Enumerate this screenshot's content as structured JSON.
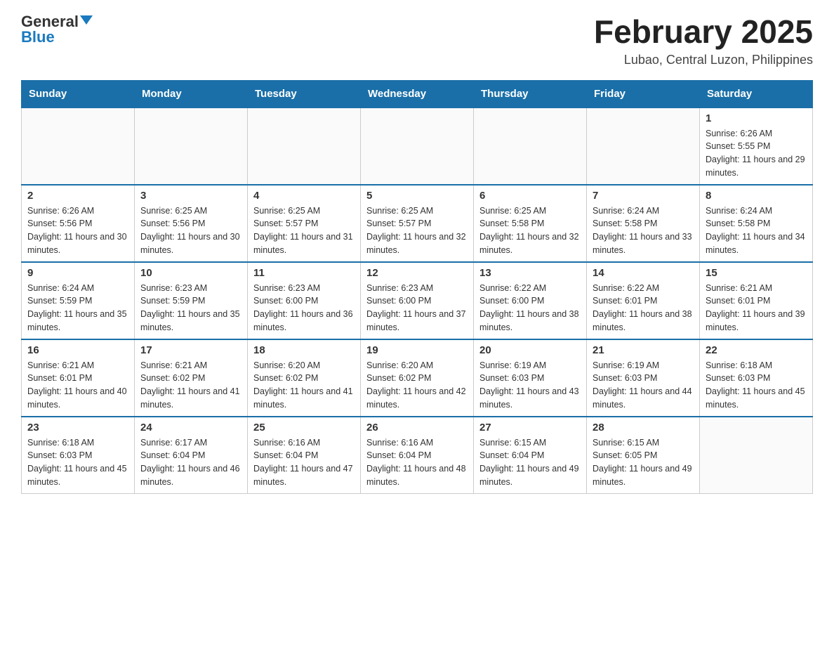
{
  "header": {
    "logo_general": "General",
    "logo_blue": "Blue",
    "title": "February 2025",
    "subtitle": "Lubao, Central Luzon, Philippines"
  },
  "days_of_week": [
    "Sunday",
    "Monday",
    "Tuesday",
    "Wednesday",
    "Thursday",
    "Friday",
    "Saturday"
  ],
  "weeks": [
    [
      {
        "day": "",
        "info": ""
      },
      {
        "day": "",
        "info": ""
      },
      {
        "day": "",
        "info": ""
      },
      {
        "day": "",
        "info": ""
      },
      {
        "day": "",
        "info": ""
      },
      {
        "day": "",
        "info": ""
      },
      {
        "day": "1",
        "info": "Sunrise: 6:26 AM\nSunset: 5:55 PM\nDaylight: 11 hours and 29 minutes."
      }
    ],
    [
      {
        "day": "2",
        "info": "Sunrise: 6:26 AM\nSunset: 5:56 PM\nDaylight: 11 hours and 30 minutes."
      },
      {
        "day": "3",
        "info": "Sunrise: 6:25 AM\nSunset: 5:56 PM\nDaylight: 11 hours and 30 minutes."
      },
      {
        "day": "4",
        "info": "Sunrise: 6:25 AM\nSunset: 5:57 PM\nDaylight: 11 hours and 31 minutes."
      },
      {
        "day": "5",
        "info": "Sunrise: 6:25 AM\nSunset: 5:57 PM\nDaylight: 11 hours and 32 minutes."
      },
      {
        "day": "6",
        "info": "Sunrise: 6:25 AM\nSunset: 5:58 PM\nDaylight: 11 hours and 32 minutes."
      },
      {
        "day": "7",
        "info": "Sunrise: 6:24 AM\nSunset: 5:58 PM\nDaylight: 11 hours and 33 minutes."
      },
      {
        "day": "8",
        "info": "Sunrise: 6:24 AM\nSunset: 5:58 PM\nDaylight: 11 hours and 34 minutes."
      }
    ],
    [
      {
        "day": "9",
        "info": "Sunrise: 6:24 AM\nSunset: 5:59 PM\nDaylight: 11 hours and 35 minutes."
      },
      {
        "day": "10",
        "info": "Sunrise: 6:23 AM\nSunset: 5:59 PM\nDaylight: 11 hours and 35 minutes."
      },
      {
        "day": "11",
        "info": "Sunrise: 6:23 AM\nSunset: 6:00 PM\nDaylight: 11 hours and 36 minutes."
      },
      {
        "day": "12",
        "info": "Sunrise: 6:23 AM\nSunset: 6:00 PM\nDaylight: 11 hours and 37 minutes."
      },
      {
        "day": "13",
        "info": "Sunrise: 6:22 AM\nSunset: 6:00 PM\nDaylight: 11 hours and 38 minutes."
      },
      {
        "day": "14",
        "info": "Sunrise: 6:22 AM\nSunset: 6:01 PM\nDaylight: 11 hours and 38 minutes."
      },
      {
        "day": "15",
        "info": "Sunrise: 6:21 AM\nSunset: 6:01 PM\nDaylight: 11 hours and 39 minutes."
      }
    ],
    [
      {
        "day": "16",
        "info": "Sunrise: 6:21 AM\nSunset: 6:01 PM\nDaylight: 11 hours and 40 minutes."
      },
      {
        "day": "17",
        "info": "Sunrise: 6:21 AM\nSunset: 6:02 PM\nDaylight: 11 hours and 41 minutes."
      },
      {
        "day": "18",
        "info": "Sunrise: 6:20 AM\nSunset: 6:02 PM\nDaylight: 11 hours and 41 minutes."
      },
      {
        "day": "19",
        "info": "Sunrise: 6:20 AM\nSunset: 6:02 PM\nDaylight: 11 hours and 42 minutes."
      },
      {
        "day": "20",
        "info": "Sunrise: 6:19 AM\nSunset: 6:03 PM\nDaylight: 11 hours and 43 minutes."
      },
      {
        "day": "21",
        "info": "Sunrise: 6:19 AM\nSunset: 6:03 PM\nDaylight: 11 hours and 44 minutes."
      },
      {
        "day": "22",
        "info": "Sunrise: 6:18 AM\nSunset: 6:03 PM\nDaylight: 11 hours and 45 minutes."
      }
    ],
    [
      {
        "day": "23",
        "info": "Sunrise: 6:18 AM\nSunset: 6:03 PM\nDaylight: 11 hours and 45 minutes."
      },
      {
        "day": "24",
        "info": "Sunrise: 6:17 AM\nSunset: 6:04 PM\nDaylight: 11 hours and 46 minutes."
      },
      {
        "day": "25",
        "info": "Sunrise: 6:16 AM\nSunset: 6:04 PM\nDaylight: 11 hours and 47 minutes."
      },
      {
        "day": "26",
        "info": "Sunrise: 6:16 AM\nSunset: 6:04 PM\nDaylight: 11 hours and 48 minutes."
      },
      {
        "day": "27",
        "info": "Sunrise: 6:15 AM\nSunset: 6:04 PM\nDaylight: 11 hours and 49 minutes."
      },
      {
        "day": "28",
        "info": "Sunrise: 6:15 AM\nSunset: 6:05 PM\nDaylight: 11 hours and 49 minutes."
      },
      {
        "day": "",
        "info": ""
      }
    ]
  ]
}
